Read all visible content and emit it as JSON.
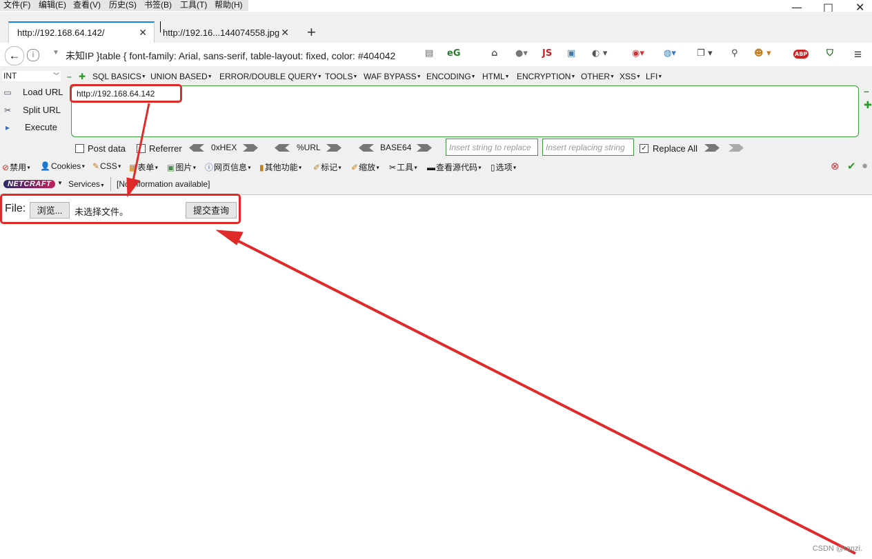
{
  "menubar": {
    "items": [
      "文件(F)",
      "编辑(E)",
      "查看(V)",
      "历史(S)",
      "书签(B)",
      "工具(T)",
      "帮助(H)"
    ],
    "window_controls": {
      "minimize": "—",
      "maximize": "□",
      "close": "✕"
    }
  },
  "tabs": [
    {
      "title": "http://192.168.64.142/",
      "close": "✕",
      "active": true
    },
    {
      "title": "http://192.16...144074558.jpg",
      "close": "✕",
      "active": false
    }
  ],
  "new_tab": "+",
  "navbar": {
    "back": "←",
    "info": "i",
    "url_text": "未知IP   }table { font-family: Arial, sans-serif, table-layout: fixed, color: #404042",
    "icons": [
      "printer-icon",
      "eg-icon",
      "home-icon",
      "globe-icon",
      "js-icon",
      "image-icon",
      "palette-icon",
      "target-icon",
      "earth-icon",
      "copy-icon",
      "zoom-icon",
      "face-icon",
      "abp-icon",
      "shield-icon"
    ],
    "js_label": "JS",
    "abp_label": "ABP",
    "menu": "≡"
  },
  "hackbar": {
    "type_select": "INT",
    "menus": [
      "SQL BASICS",
      "UNION BASED",
      "ERROR/DOUBLE QUERY",
      "TOOLS",
      "WAF BYPASS",
      "ENCODING",
      "HTML",
      "ENCRYPTION",
      "OTHER",
      "XSS",
      "LFI"
    ],
    "load_url": "Load URL",
    "split_url": "Split URL",
    "execute": "Execute",
    "url_value": "http://192.168.64.142",
    "post_data": "Post data",
    "referrer": "Referrer",
    "hex": "0xHEX",
    "url_enc": "%URL",
    "base64": "BASE64",
    "insert_placeholder": "Insert string to replace",
    "replacing_placeholder": "Insert replacing string",
    "replace_all": "Replace All"
  },
  "toolbar2": {
    "items": [
      "禁用",
      "Cookies",
      "CSS",
      "表单",
      "图片",
      "网页信息",
      "其他功能",
      "标记",
      "缩放",
      "工具",
      "查看源代码",
      "选项"
    ]
  },
  "netcraft": {
    "logo": "NETCRAFT",
    "services": "Services",
    "info": "[No information available]"
  },
  "form": {
    "file_label": "File:",
    "browse": "浏览...",
    "no_file": "未选择文件。",
    "submit": "提交查询"
  },
  "watermark": "CSDN @ranzi.",
  "colors": {
    "annotation": "#e02a2a",
    "hackbar_border": "#3a9c3a",
    "tab_accent": "#0a84ff"
  }
}
